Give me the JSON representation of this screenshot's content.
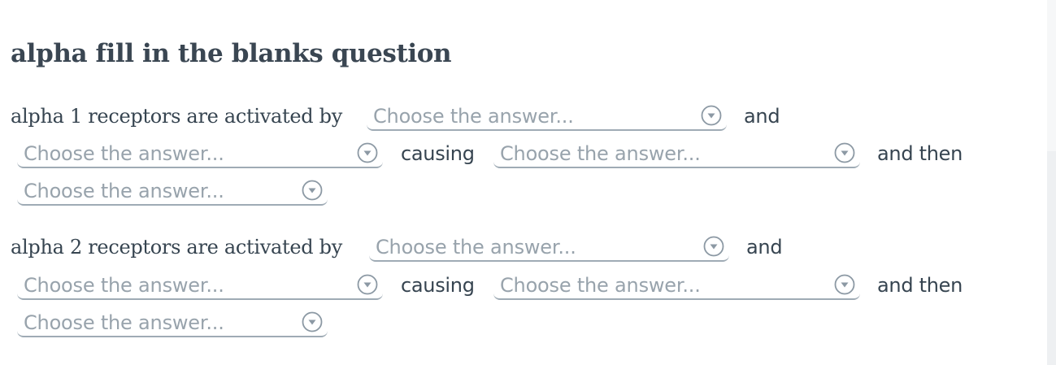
{
  "question": {
    "title": "alpha fill in the blanks question",
    "rows": [
      {
        "lead": "alpha 1 receptors are activated by",
        "conj_and": "and",
        "conj_causing": "causing",
        "conj_and_then": "and then"
      },
      {
        "lead": "alpha 2 receptors are activated by",
        "conj_and": "and",
        "conj_causing": "causing",
        "conj_and_then": "and then"
      }
    ],
    "dropdown_placeholder": "Choose the answer...",
    "dropdown_icon": "chevron-down-circle-icon"
  }
}
